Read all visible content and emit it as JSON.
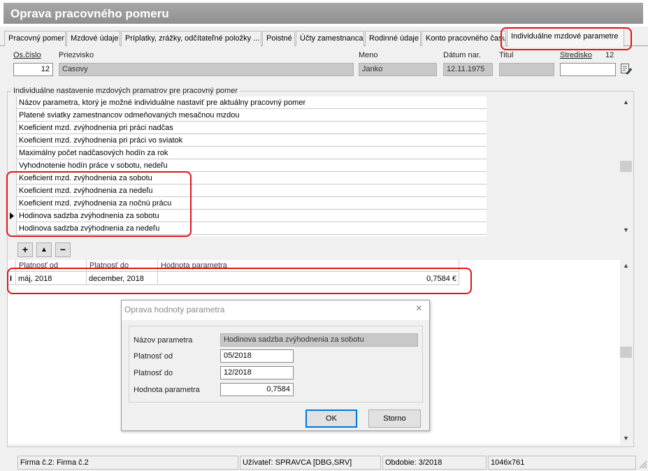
{
  "window": {
    "title": "Oprava pracovného pomeru"
  },
  "tabs": [
    "Pracovný pomer",
    "Mzdové údaje",
    "Príplatky, zrážky, odčítateľné položky ...",
    "Poistné",
    "Účty zamestnanca",
    "Rodinné údaje",
    "Konto pracovného času",
    "Individuálne mzdové parametre"
  ],
  "header": {
    "os_cislo_label": "Os.číslo",
    "os_cislo_value": "12",
    "priezvisko_label": "Priezvisko",
    "priezvisko_value": "Casovy",
    "meno_label": "Meno",
    "meno_value": "Janko",
    "datum_label": "Dátum nar.",
    "datum_value": "12.11.1975",
    "titul_label": "Titul",
    "titul_value": "",
    "stredisko_label": "Stredisko",
    "stredisko_number": "12",
    "stredisko_value": ""
  },
  "group_label": "Individuálne nastavenie mzdových pramatrov pre pracovný pomer",
  "params": [
    "Názov parametra, ktorý je možné individuálne nastaviť pre aktuálny pracovný pomer",
    "Platené sviatky zamestnancov odmeňovaných mesačnou mzdou",
    "Koeficient mzd. zvýhodnenia pri práci nadčas",
    "Koeficient mzd. zvýhodnenia pri práci vo sviatok",
    "Maximálny počet nadčasových hodín za rok",
    "Vyhodnotenie hodín práce v sobotu, nedeľu",
    "Koeficient mzd. zvýhodnenia za sobotu",
    "Koeficient mzd. zvýhodnenia za nedeľu",
    "Koeficient mzd. zvýhodnenia za nočnú prácu",
    "Hodinova sadzba zvýhodnenia za sobotu",
    "Hodinova sadzba zvýhodnenia za nedeľu"
  ],
  "toolbar": {
    "add": "+",
    "up": "▲",
    "remove": "−"
  },
  "values_table": {
    "headers": [
      "Platnosť od",
      "Platnosť do",
      "Hodnota parametra"
    ],
    "row": {
      "marker": "I",
      "od": "máj, 2018",
      "do": "december, 2018",
      "hodnota": "0,7584 €"
    }
  },
  "dialog": {
    "title": "Oprava hodnoty parametra",
    "close": "×",
    "nazov_label": "Názov parametra",
    "nazov_value": "Hodinova sadzba zvýhodnenia za sobotu",
    "od_label": "Platnosť od",
    "od_value": "05/2018",
    "do_label": "Platnosť do",
    "do_value": "12/2018",
    "hodnota_label": "Hodnota parametra",
    "hodnota_value": "0,7584",
    "ok": "OK",
    "cancel": "Storno"
  },
  "status": {
    "firma": "Firma č.2: Firma č.2",
    "uzivatel": "Užívateľ: SPRAVCA [DBG,SRV]",
    "obdobie": "Obdobie: 3/2018",
    "size": "1046x761"
  },
  "colors": {
    "highlight": "#e01515",
    "titlebar": "#9a9a9a",
    "focus": "#0078d7"
  }
}
